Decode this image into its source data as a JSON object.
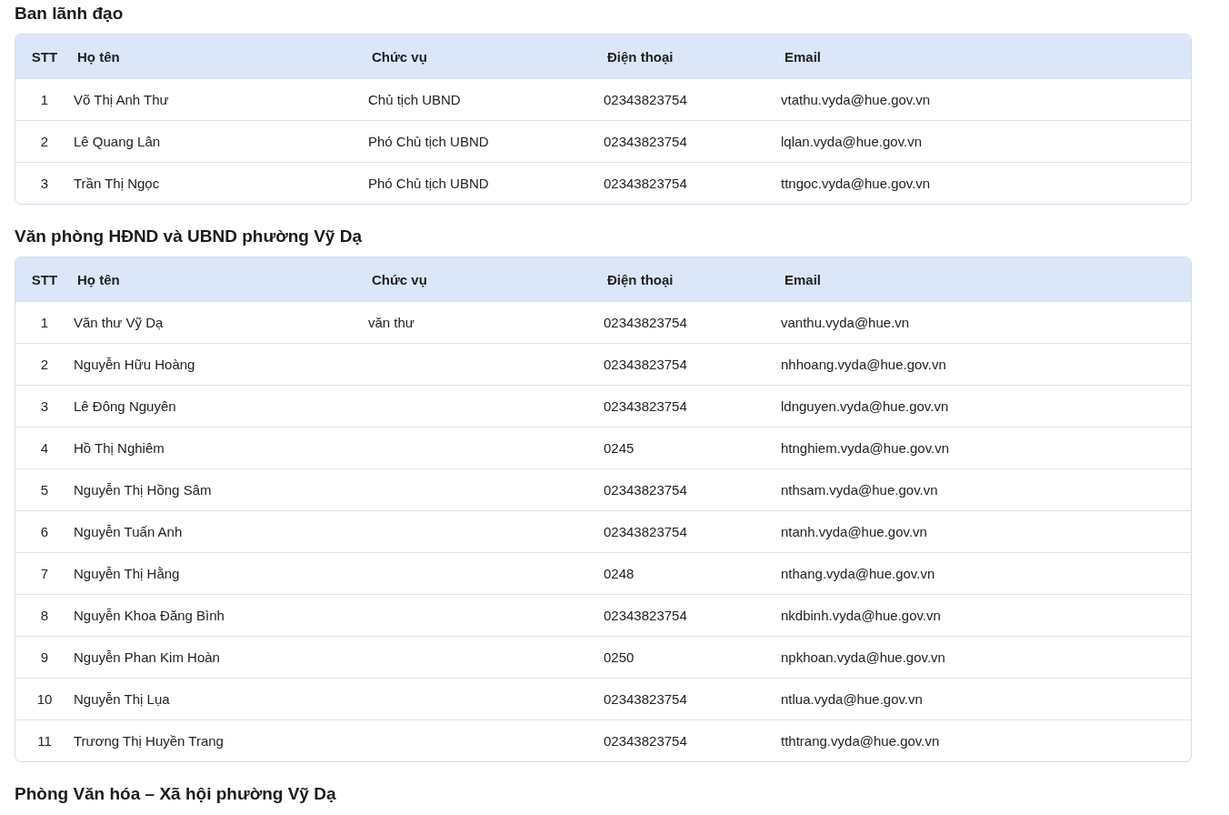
{
  "sections": [
    {
      "title": "Ban lãnh đạo",
      "columns": [
        "STT",
        "Họ tên",
        "Chức vụ",
        "Điện thoại",
        "Email"
      ],
      "rows": [
        [
          "1",
          "Võ Thị Anh Thư",
          "Chủ tịch UBND",
          "02343823754",
          "vtathu.vyda@hue.gov.vn"
        ],
        [
          "2",
          "Lê Quang Lân",
          "Phó Chủ tịch UBND",
          "02343823754",
          "lqlan.vyda@hue.gov.vn"
        ],
        [
          "3",
          "Trần Thị Ngọc",
          "Phó Chủ tịch UBND",
          "02343823754",
          "ttngoc.vyda@hue.gov.vn"
        ]
      ]
    },
    {
      "title": "Văn phòng HĐND và UBND phường Vỹ Dạ",
      "columns": [
        "STT",
        "Họ tên",
        "Chức vụ",
        "Điện thoại",
        "Email"
      ],
      "rows": [
        [
          "1",
          "Văn thư Vỹ Dạ",
          "văn thư",
          "02343823754",
          "vanthu.vyda@hue.vn"
        ],
        [
          "2",
          "Nguyễn Hữu Hoàng",
          "",
          "02343823754",
          "nhhoang.vyda@hue.gov.vn"
        ],
        [
          "3",
          "Lê Đông Nguyên",
          "",
          "02343823754",
          "ldnguyen.vyda@hue.gov.vn"
        ],
        [
          "4",
          "Hồ Thị Nghiêm",
          "",
          "0245",
          "htnghiem.vyda@hue.gov.vn"
        ],
        [
          "5",
          "Nguyễn Thị Hồng Sâm",
          "",
          "02343823754",
          "nthsam.vyda@hue.gov.vn"
        ],
        [
          "6",
          "Nguyễn Tuấn Anh",
          "",
          "02343823754",
          "ntanh.vyda@hue.gov.vn"
        ],
        [
          "7",
          "Nguyễn Thị Hằng",
          "",
          "0248",
          "nthang.vyda@hue.gov.vn"
        ],
        [
          "8",
          "Nguyễn Khoa Đăng Bình",
          "",
          "02343823754",
          "nkdbinh.vyda@hue.gov.vn"
        ],
        [
          "9",
          "Nguyễn Phan Kim Hoàn",
          "",
          "0250",
          "npkhoan.vyda@hue.gov.vn"
        ],
        [
          "10",
          "Nguyễn Thị Lụa",
          "",
          "02343823754",
          "ntlua.vyda@hue.gov.vn"
        ],
        [
          "11",
          "Trương Thị Huyền Trang",
          "",
          "02343823754",
          "tthtrang.vyda@hue.gov.vn"
        ]
      ]
    },
    {
      "title": "Phòng Văn hóa – Xã hội phường Vỹ Dạ"
    }
  ]
}
